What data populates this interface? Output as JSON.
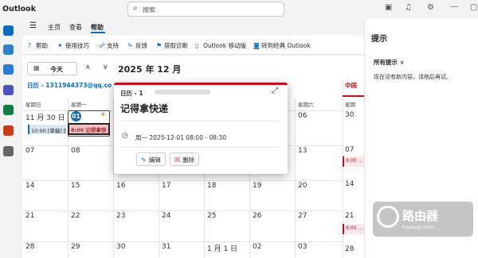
{
  "app": {
    "name": "Outlook"
  },
  "search": {
    "placeholder": "搜索"
  },
  "menu": {
    "items": [
      "主页",
      "查看",
      "帮助"
    ],
    "active": "帮助"
  },
  "ribbon": {
    "items": [
      {
        "label": "帮助",
        "icon": "question-icon"
      },
      {
        "label": "使用技巧",
        "icon": "lightbulb-icon"
      },
      {
        "label": "支持",
        "icon": "support-icon"
      },
      {
        "label": "反馈",
        "icon": "feedback-icon"
      },
      {
        "label": "获取诊断",
        "icon": "diagnostics-icon"
      },
      {
        "label": "Outlook 移动版",
        "icon": "mobile-icon"
      },
      {
        "label": "转到经典 Outlook",
        "icon": "outlook-classic-icon"
      }
    ]
  },
  "nav": {
    "today": "今天",
    "month_title": "2025 年 12 月"
  },
  "calendar": {
    "header": "日历 - 1311944373@qq.co",
    "weekdays": [
      "星期日",
      "星期一",
      "星期二",
      "星期三",
      "星期四",
      "星期五",
      "星期六"
    ],
    "weeks": [
      [
        "11 月 30 日",
        "01",
        "02",
        "03",
        "04",
        "05",
        "06"
      ],
      [
        "07",
        "08",
        "09",
        "10",
        "11",
        "12",
        "13"
      ],
      [
        "14",
        "15",
        "16",
        "17",
        "18",
        "19",
        "20"
      ],
      [
        "21",
        "22",
        "23",
        "24",
        "25",
        "26",
        "27"
      ],
      [
        "28",
        "29",
        "30",
        "31",
        "1 月 1 日",
        "02",
        "03"
      ]
    ],
    "events": {
      "sun_event": "10:00 [草稿] 回",
      "mon_event": "8:00 记得拿快"
    }
  },
  "china_calendar": {
    "header": "中国",
    "weekday": "星期",
    "days": [
      "30",
      "07",
      "14",
      "21",
      "28"
    ],
    "events": [
      "8:00 ...",
      "8:00 ..."
    ]
  },
  "popup": {
    "calendar_label": "日历 - 1",
    "title": "记得拿快递",
    "time": "周一 2025-12-01 08:00 - 08:30",
    "edit": "编辑",
    "delete": "删除"
  },
  "right_pane": {
    "title": "提示",
    "section": "所有提示",
    "message": "现在没有新内容。请稍后再试。"
  },
  "watermark": {
    "text": "路由器",
    "url": "luyouqi.com"
  }
}
